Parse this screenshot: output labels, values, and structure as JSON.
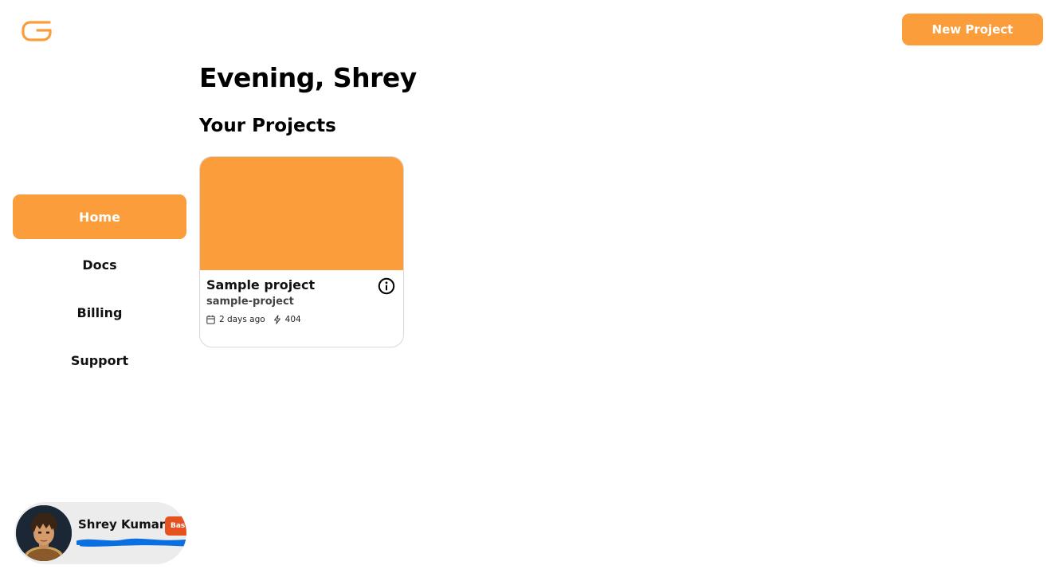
{
  "colors": {
    "accent": "#fa9d3a",
    "badge": "#e6521f",
    "redaction": "#0a6fe0"
  },
  "header": {
    "logo_icon": "g-logo-icon",
    "new_project_label": "New Project"
  },
  "sidebar": {
    "items": [
      {
        "label": "Home",
        "active": true
      },
      {
        "label": "Docs",
        "active": false
      },
      {
        "label": "Billing",
        "active": false
      },
      {
        "label": "Support",
        "active": false
      }
    ]
  },
  "main": {
    "greeting": "Evening, Shrey",
    "section_title": "Your Projects",
    "projects": [
      {
        "title": "Sample project",
        "slug": "sample-project",
        "updated": "2 days ago",
        "requests": "404",
        "icons": {
          "info": "info-icon",
          "date": "calendar-icon",
          "requests": "lightning-icon"
        }
      }
    ]
  },
  "user": {
    "name": "Shrey Kumar",
    "plan": "Bas",
    "avatar_icon": "avatar"
  }
}
